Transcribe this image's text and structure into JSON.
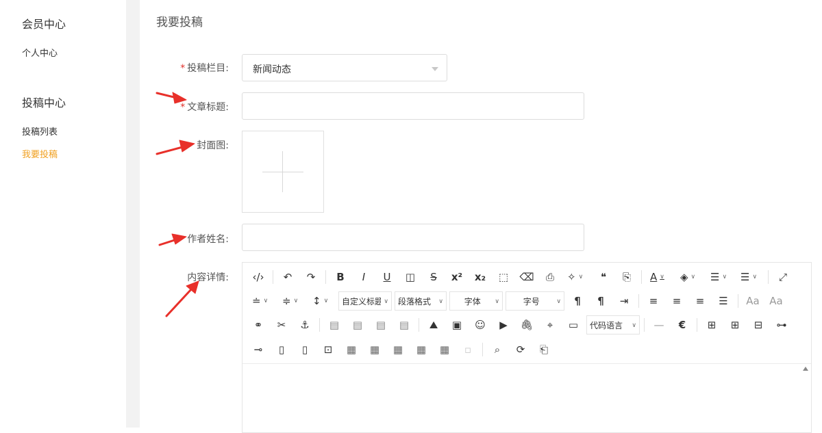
{
  "sidebar": {
    "groups": [
      {
        "title": "会员中心",
        "items": [
          {
            "label": "个人中心",
            "active": false
          }
        ]
      },
      {
        "title": "投稿中心",
        "items": [
          {
            "label": "投稿列表",
            "active": false
          },
          {
            "label": "我要投稿",
            "active": true
          }
        ]
      }
    ],
    "active_color": "#f0a020"
  },
  "main": {
    "title": "我要投稿",
    "form": {
      "category": {
        "label": "投稿栏目:",
        "required": true,
        "value": "新闻动态"
      },
      "article_title": {
        "label": "文章标题:",
        "required": true,
        "value": ""
      },
      "cover": {
        "label": "封面图:"
      },
      "author": {
        "label": "作者姓名:",
        "value": ""
      },
      "content": {
        "label": "内容详情:"
      }
    },
    "editor": {
      "selects": {
        "custom_heading": "自定义标题",
        "paragraph_format": "段落格式",
        "font_family": "字体",
        "font_size": "字号",
        "code_language": "代码语言"
      }
    }
  },
  "colors": {
    "required_mark": "#e0302a",
    "annotation_arrow": "#e8302a",
    "gutter": "#f2f2f2"
  }
}
